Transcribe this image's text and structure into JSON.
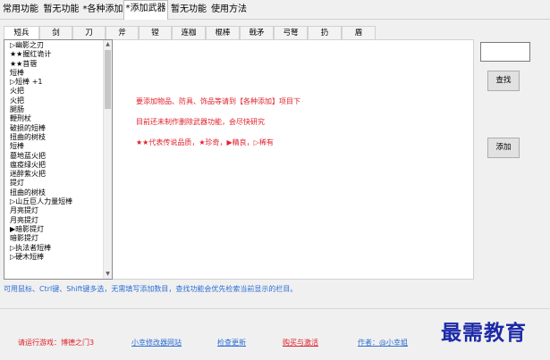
{
  "top_tabs": [
    {
      "label": "常用功能",
      "active": false
    },
    {
      "label": "暂无功能",
      "active": false
    },
    {
      "label": "*各种添加",
      "active": false
    },
    {
      "label": "*添加武器",
      "active": true
    },
    {
      "label": "暂无功能",
      "active": false
    },
    {
      "label": "使用方法",
      "active": false
    }
  ],
  "weapon_tabs": [
    {
      "label": "短兵",
      "active": true
    },
    {
      "label": "剑",
      "active": false
    },
    {
      "label": "刀",
      "active": false
    },
    {
      "label": "斧",
      "active": false
    },
    {
      "label": "镗",
      "active": false
    },
    {
      "label": "连枷",
      "active": false
    },
    {
      "label": "棍棒",
      "active": false
    },
    {
      "label": "戟矛",
      "active": false
    },
    {
      "label": "弓弩",
      "active": false
    },
    {
      "label": "扔",
      "active": false
    },
    {
      "label": "盾",
      "active": false
    }
  ],
  "item_list": [
    "▷幽影之刃",
    "★★握红诡计",
    "★★苜蓿",
    "短棒",
    "▷短棒 +1",
    "火把",
    "火把",
    "腿肠",
    "鞭刑杖",
    "破损的短棒",
    "扭曲的树枝",
    "短棒",
    "墓地蓝火把",
    "瘟疫绿火把",
    "迷醉紫火把",
    "提灯",
    "扭曲的树枝",
    "▷山丘巨人力量短棒",
    "月亮提灯",
    "月亮提灯",
    "▶暗影提灯",
    "暗影提灯",
    "▷执法者短棒",
    "▷硬木短棒"
  ],
  "info_lines": [
    "要添加物品、防具、饰品等请到【各种添加】项目下",
    "目前还未制作删除武器功能，会尽快研究",
    "★★代表传说品质，★珍奇，▶精良，▷稀有"
  ],
  "search": {
    "value": "",
    "button": "查找"
  },
  "add_button": "添加",
  "hint": "可用鼠标、Ctrl键、Shift键多选，无需填写添加数目，查找功能会优先检索当前显示的栏目。",
  "footer": {
    "game": "请运行游戏：博德之门3",
    "website": "小幸修改器网站",
    "update": "检查更新",
    "buy": "购买与激活",
    "author": "作者：@小幸姐"
  },
  "watermark": "最需教育",
  "colors": {
    "red": "#e0202a",
    "blue": "#2e6fd6",
    "watermark": "#1c2aa8"
  }
}
